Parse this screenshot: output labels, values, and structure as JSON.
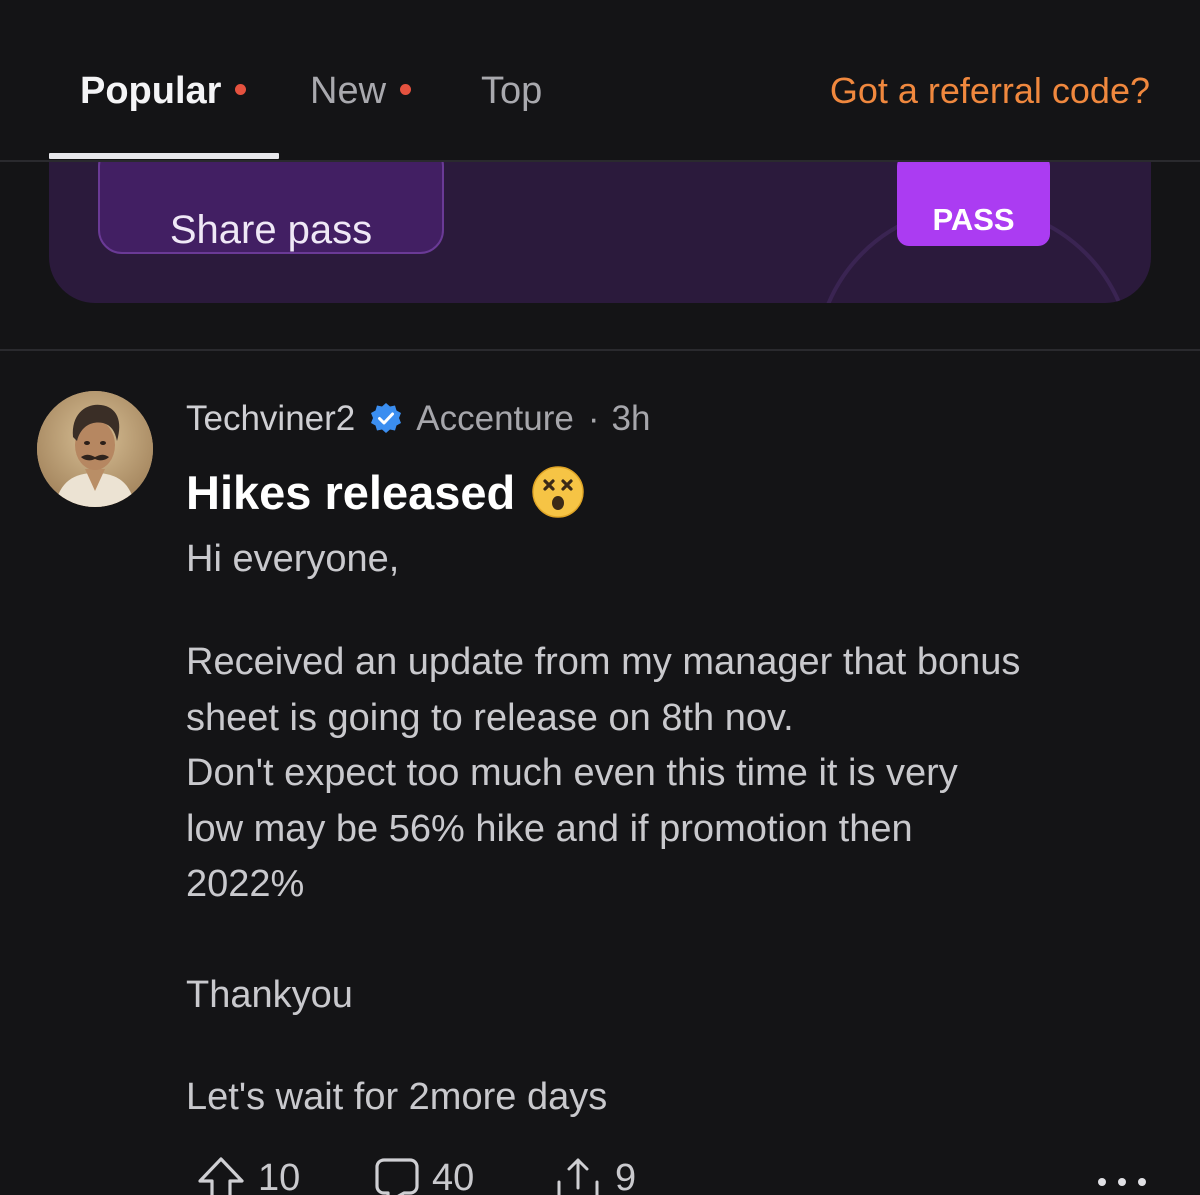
{
  "tabs": {
    "items": [
      {
        "label": "Popular",
        "active": true,
        "has_dot": true
      },
      {
        "label": "New",
        "active": false,
        "has_dot": true
      },
      {
        "label": "Top",
        "active": false,
        "has_dot": false
      }
    ],
    "referral_link": "Got a referral code?"
  },
  "promo": {
    "share_button": "Share pass",
    "badge": "PASS"
  },
  "post": {
    "author": "Techviner2",
    "verified": true,
    "company": "Accenture",
    "separator": "·",
    "time": "3h",
    "title": "Hikes released",
    "title_emoji": "dizzy-face-emoji",
    "body": [
      "Hi everyone,",
      "Received an update from my manager that bonus\nsheet is going to release on 8th nov.\nDon't expect too much even this time it is very\nlow may be 56% hike and if promotion then\n2022%",
      "Thankyou",
      "Let's wait for 2more days"
    ],
    "actions": {
      "upvotes": "10",
      "comments": "40",
      "shares": "9"
    }
  },
  "colors": {
    "background": "#141416",
    "accent_orange": "#f0883e",
    "tab_dot": "#e5523f",
    "promo_bg": "#2b1a3c",
    "pass_badge": "#ab3cf2",
    "verified_blue": "#3b8ef0"
  }
}
